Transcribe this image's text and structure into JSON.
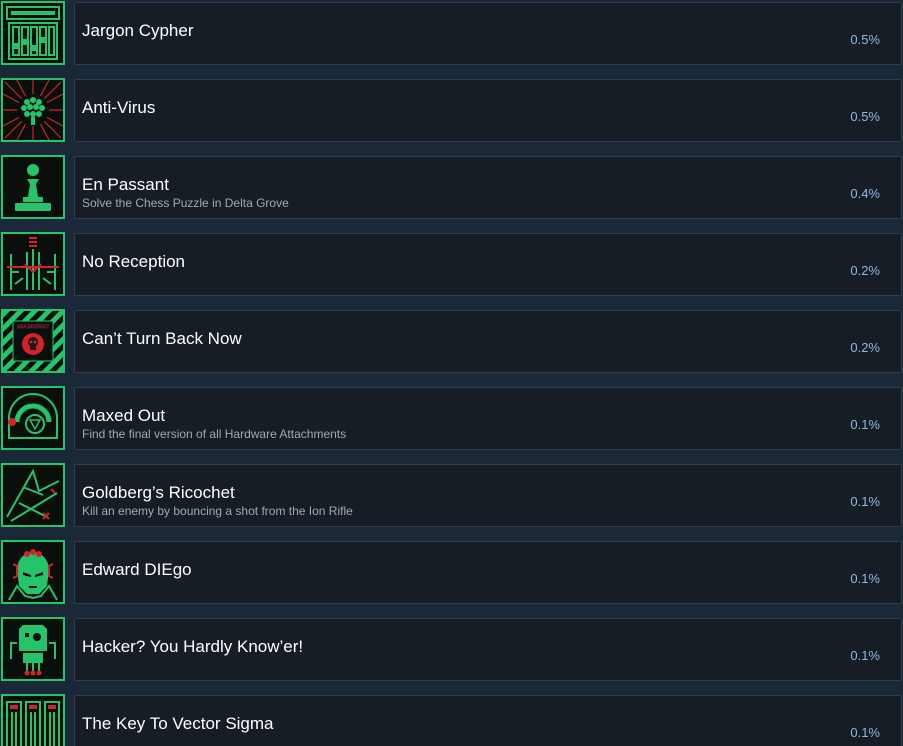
{
  "achievements": [
    {
      "title": "Jargon Cypher",
      "description": "",
      "percent": "0.5%",
      "icon": "keyboard-cypher-icon"
    },
    {
      "title": "Anti-Virus",
      "description": "",
      "percent": "0.5%",
      "icon": "virus-burst-icon"
    },
    {
      "title": "En Passant",
      "description": "Solve the Chess Puzzle in Delta Grove",
      "percent": "0.4%",
      "icon": "chess-pawn-icon"
    },
    {
      "title": "No Reception",
      "description": "",
      "percent": "0.2%",
      "icon": "antenna-tower-icon"
    },
    {
      "title": "Can’t Turn Back Now",
      "description": "",
      "percent": "0.2%",
      "icon": "self-destruct-skull-icon"
    },
    {
      "title": "Maxed Out",
      "description": "Find the final version of all Hardware Attachments",
      "percent": "0.1%",
      "icon": "hardware-gauge-icon"
    },
    {
      "title": "Goldberg’s Ricochet",
      "description": "Kill an enemy by bouncing a shot from the Ion Rifle",
      "percent": "0.1%",
      "icon": "ricochet-shot-icon"
    },
    {
      "title": "Edward DIEgo",
      "description": "",
      "percent": "0.1%",
      "icon": "cyborg-face-icon"
    },
    {
      "title": "Hacker? You Hardly Know’er!",
      "description": "",
      "percent": "0.1%",
      "icon": "circuit-chip-icon"
    },
    {
      "title": "The Key To Vector Sigma",
      "description": "",
      "percent": "0.1%",
      "icon": "server-rack-icon"
    }
  ],
  "icon_stamp_text": "SELF DESTRUCT",
  "colors": {
    "background": "#1b2838",
    "card": "#161d25",
    "card_border": "#2f3e4e",
    "icon_green": "#25c46b",
    "icon_red": "#d3222a",
    "percent": "#8fb8e6"
  }
}
